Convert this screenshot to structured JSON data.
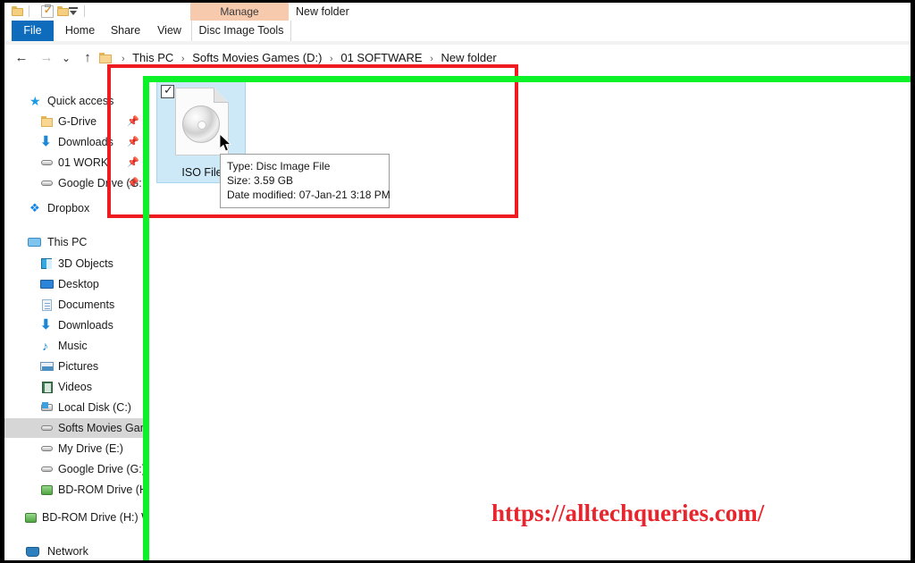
{
  "window": {
    "title": "New folder",
    "contextual_header": "Manage"
  },
  "quick_access_toolbar": {
    "items": [
      {
        "name": "folder-icon",
        "label": ""
      },
      {
        "name": "properties-icon",
        "label": ""
      },
      {
        "name": "new-folder-icon",
        "label": ""
      },
      {
        "name": "customize-dropdown-icon",
        "label": ""
      }
    ]
  },
  "ribbon": {
    "tabs": [
      {
        "label": "File",
        "active": false,
        "style": "file"
      },
      {
        "label": "Home",
        "active": false,
        "style": "normal"
      },
      {
        "label": "Share",
        "active": false,
        "style": "normal"
      },
      {
        "label": "View",
        "active": false,
        "style": "normal"
      },
      {
        "label": "Disc Image Tools",
        "active": true,
        "style": "contextual"
      }
    ]
  },
  "address_bar": {
    "back_icon": "←",
    "forward_icon": "→",
    "recent_icon": "⌄",
    "up_icon": "↑",
    "breadcrumb": [
      "This PC",
      "Softs Movies Games (D:)",
      "01 SOFTWARE",
      "New folder"
    ],
    "separator": "›"
  },
  "sidebar": {
    "items": [
      {
        "label": "Quick access",
        "icon": "star-icon",
        "indent": 28,
        "pinned": false,
        "selected": false,
        "icon_class": "ico-star",
        "glyph": "★"
      },
      {
        "label": "G-Drive",
        "icon": "folder-icon",
        "indent": 40,
        "pinned": true,
        "selected": false,
        "icon_class": "ico-folder",
        "glyph": ""
      },
      {
        "label": "Downloads",
        "icon": "download-icon",
        "indent": 40,
        "pinned": true,
        "selected": false,
        "icon_class": "ico-dl",
        "glyph": "⬇"
      },
      {
        "label": "01 WORK",
        "icon": "drive-icon",
        "indent": 40,
        "pinned": true,
        "selected": false,
        "icon_class": "ico-hdd",
        "glyph": ""
      },
      {
        "label": "Google Drive (G:",
        "icon": "drive-icon",
        "indent": 40,
        "pinned": true,
        "selected": false,
        "icon_class": "ico-hdd",
        "glyph": ""
      },
      {
        "label": "Dropbox",
        "icon": "dropbox-icon",
        "indent": 28,
        "pinned": false,
        "selected": false,
        "icon_class": "ico-dropbox",
        "glyph": "❖"
      },
      {
        "label": "This PC",
        "icon": "pc-icon",
        "indent": 28,
        "pinned": false,
        "selected": false,
        "icon_class": "ico-pc",
        "glyph": ""
      },
      {
        "label": "3D Objects",
        "icon": "3d-objects-icon",
        "indent": 40,
        "pinned": false,
        "selected": false,
        "icon_class": "ico-3d",
        "glyph": ""
      },
      {
        "label": "Desktop",
        "icon": "desktop-icon",
        "indent": 40,
        "pinned": false,
        "selected": false,
        "icon_class": "ico-desktop",
        "glyph": ""
      },
      {
        "label": "Documents",
        "icon": "documents-icon",
        "indent": 40,
        "pinned": false,
        "selected": false,
        "icon_class": "ico-doc",
        "glyph": ""
      },
      {
        "label": "Downloads",
        "icon": "download-icon",
        "indent": 40,
        "pinned": false,
        "selected": false,
        "icon_class": "ico-dl",
        "glyph": "⬇"
      },
      {
        "label": "Music",
        "icon": "music-icon",
        "indent": 40,
        "pinned": false,
        "selected": false,
        "icon_class": "ico-music",
        "glyph": "♪"
      },
      {
        "label": "Pictures",
        "icon": "pictures-icon",
        "indent": 40,
        "pinned": false,
        "selected": false,
        "icon_class": "ico-pic",
        "glyph": ""
      },
      {
        "label": "Videos",
        "icon": "videos-icon",
        "indent": 40,
        "pinned": false,
        "selected": false,
        "icon_class": "ico-video",
        "glyph": ""
      },
      {
        "label": "Local Disk (C:)",
        "icon": "local-disk-icon",
        "indent": 40,
        "pinned": false,
        "selected": false,
        "icon_class": "ico-localdisk",
        "glyph": ""
      },
      {
        "label": "Softs Movies Games",
        "icon": "drive-icon",
        "indent": 40,
        "pinned": false,
        "selected": true,
        "icon_class": "ico-hdd",
        "glyph": ""
      },
      {
        "label": "My Drive (E:)",
        "icon": "drive-icon",
        "indent": 40,
        "pinned": false,
        "selected": false,
        "icon_class": "ico-hdd",
        "glyph": ""
      },
      {
        "label": "Google Drive (G:)",
        "icon": "drive-icon",
        "indent": 40,
        "pinned": false,
        "selected": false,
        "icon_class": "ico-hdd",
        "glyph": ""
      },
      {
        "label": "BD-ROM Drive (H:)",
        "icon": "bd-rom-icon",
        "indent": 40,
        "pinned": false,
        "selected": false,
        "icon_class": "ico-bdrom",
        "glyph": ""
      },
      {
        "label": "BD-ROM Drive (H:) W",
        "icon": "bd-rom-icon",
        "indent": 28,
        "pinned": false,
        "selected": false,
        "icon_class": "ico-bdrom",
        "glyph": ""
      },
      {
        "label": "Network",
        "icon": "network-icon",
        "indent": 28,
        "pinned": false,
        "selected": false,
        "icon_class": "ico-network",
        "glyph": ""
      }
    ],
    "pin_glyph": "📌"
  },
  "content": {
    "file": {
      "name": "ISO File",
      "checkbox_checked": true,
      "checkbox_glyph": "✓",
      "icon": "iso-disc-image-icon"
    },
    "tooltip": {
      "lines": [
        "Type: Disc Image File",
        "Size: 3.59 GB",
        "Date modified: 07-Jan-21 3:18 PM"
      ],
      "type_line": "Type: Disc Image File",
      "size_line": "Size: 3.59 GB",
      "date_line": "Date modified: 07-Jan-21 3:18 PM"
    }
  },
  "annotations": {
    "red_box_color": "#ee1c21",
    "green_line_color": "#0cf228",
    "watermark": "https://alltechqueries.com/",
    "watermark_color": "#e8242c"
  },
  "colors": {
    "file_tab_blue": "#0f6cbd",
    "contextual_peach": "#f7c9ad",
    "selection_blue": "#cde8f7",
    "sidebar_selected_gray": "#d6d6d6"
  }
}
